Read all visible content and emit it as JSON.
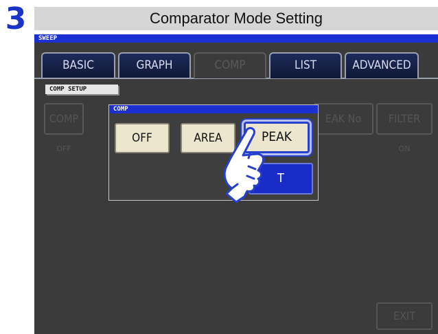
{
  "step": "3",
  "title": "Comparator Mode Setting",
  "mode_label": "SWEEP",
  "tabs": [
    {
      "label": "BASIC"
    },
    {
      "label": "GRAPH"
    },
    {
      "label": "COMP"
    },
    {
      "label": "LIST"
    },
    {
      "label": "ADVANCED"
    }
  ],
  "section_label": "COMP SETUP",
  "background_buttons": {
    "comp": {
      "label": "COMP",
      "value": "OFF"
    },
    "peak_no": {
      "label": "EAK No"
    },
    "filter": {
      "label": "FILTER",
      "value": "ON"
    }
  },
  "dialog": {
    "title": "COMP",
    "options": [
      {
        "label": "OFF"
      },
      {
        "label": "AREA"
      },
      {
        "label": "PEAK",
        "selected": true
      }
    ],
    "set_label": "T"
  },
  "exit_label": "EXIT",
  "colors": {
    "accent_blue": "#1c2fd0",
    "step_number": "#1a34c8",
    "screen_bg": "#3b3b3b",
    "option_bg": "#ece6cf"
  },
  "icons": {
    "pointer": "pointing-hand-icon"
  }
}
